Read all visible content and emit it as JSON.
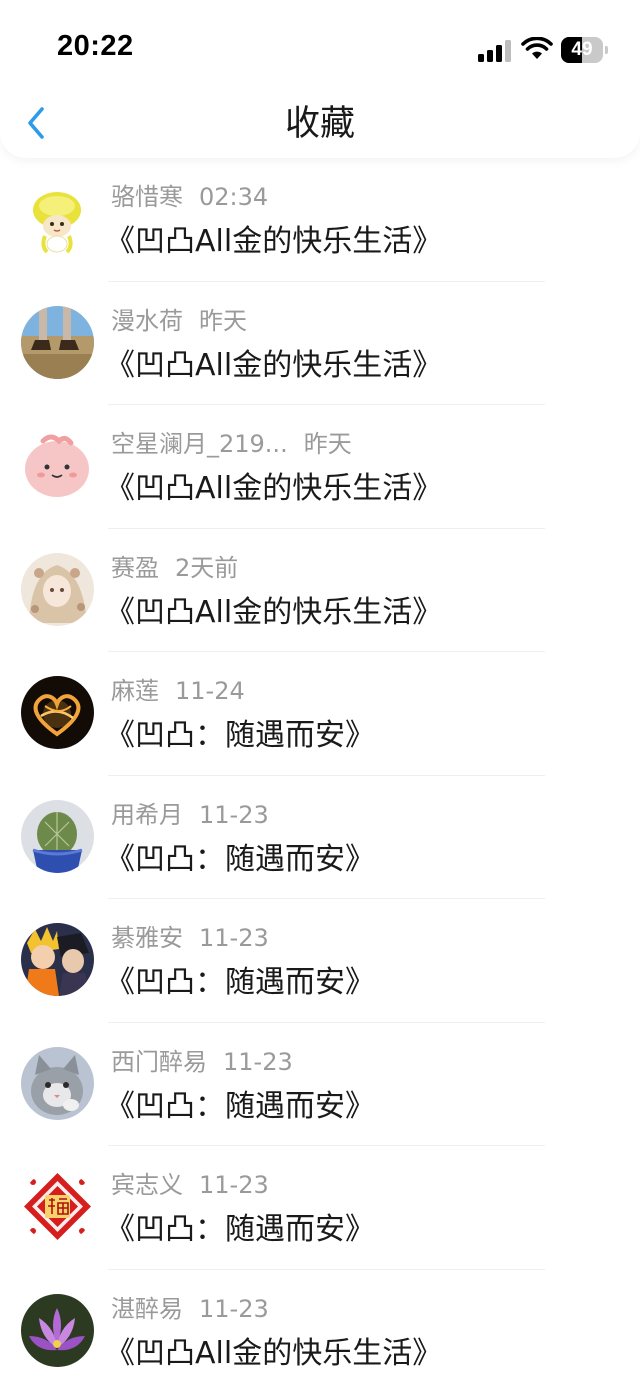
{
  "status_bar": {
    "time": "20:22",
    "battery_level": "49",
    "battery_fraction": 0.49,
    "icons": [
      "signal-icon",
      "wifi-icon",
      "battery-icon"
    ]
  },
  "nav": {
    "title": "收藏",
    "back_icon": "chevron-left-icon",
    "accent_color": "#2e9be8"
  },
  "items": [
    {
      "name": "骆惜寒",
      "time": "02:34",
      "title": "《凹凸All金的快乐生活》",
      "avatar": "yellow-jellyfish-avatar"
    },
    {
      "name": "漫水荷",
      "time": "昨天",
      "title": "《凹凸All金的快乐生活》",
      "avatar": "boots-on-ground-avatar"
    },
    {
      "name": "空星澜月_219...",
      "time": "昨天",
      "title": "《凹凸All金的快乐生活》",
      "avatar": "pink-blob-avatar"
    },
    {
      "name": "赛盈",
      "time": "2天前",
      "title": "《凹凸All金的快乐生活》",
      "avatar": "anime-girl-avatar"
    },
    {
      "name": "麻莲",
      "time": "11-24",
      "title": "《凹凸：随遇而安》",
      "avatar": "light-heart-avatar"
    },
    {
      "name": "用希月",
      "time": "11-23",
      "title": "《凹凸：随遇而安》",
      "avatar": "cactus-avatar"
    },
    {
      "name": "綦雅安",
      "time": "11-23",
      "title": "《凹凸：随遇而安》",
      "avatar": "anime-duo-avatar"
    },
    {
      "name": "西门醉易",
      "time": "11-23",
      "title": "《凹凸：随遇而安》",
      "avatar": "cat-avatar"
    },
    {
      "name": "宾志义",
      "time": "11-23",
      "title": "《凹凸：随遇而安》",
      "avatar": "fu-character-avatar"
    },
    {
      "name": "湛醉易",
      "time": "11-23",
      "title": "《凹凸All金的快乐生活》",
      "avatar": "purple-lotus-avatar"
    }
  ]
}
